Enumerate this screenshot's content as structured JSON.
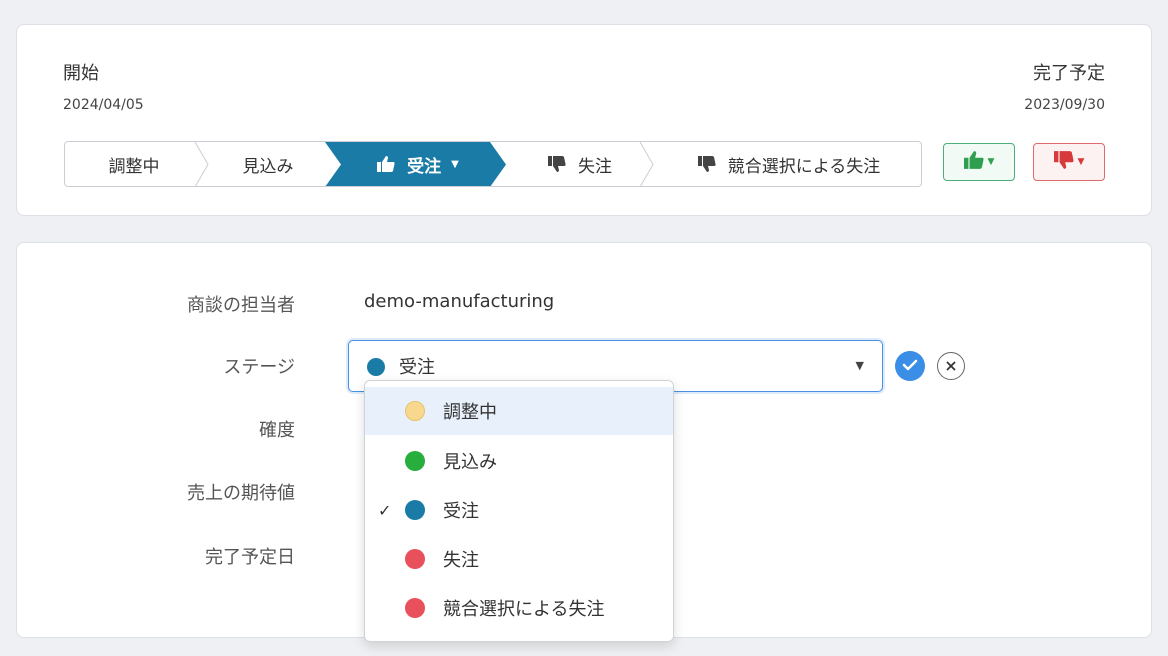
{
  "header": {
    "start_label": "開始",
    "start_date": "2024/04/05",
    "end_label": "完了予定",
    "end_date": "2023/09/30"
  },
  "stage_path": {
    "stages": [
      {
        "label": "調整中",
        "icon": null,
        "active": false
      },
      {
        "label": "見込み",
        "icon": null,
        "active": false
      },
      {
        "label": "受注",
        "icon": "thumbs-up-icon",
        "active": true
      },
      {
        "label": "失注",
        "icon": "thumbs-down-icon",
        "active": false
      },
      {
        "label": "競合選択による失注",
        "icon": "thumbs-down-icon",
        "active": false
      }
    ],
    "active_color": "#1a7ba6"
  },
  "vote_buttons": {
    "up_color": "#2e9e4f",
    "down_color": "#d63a3a"
  },
  "form": {
    "owner_label": "商談の担当者",
    "owner_value": "demo-manufacturing",
    "stage_label": "ステージ",
    "stage_value": "受注",
    "stage_color": "#1a7ba6",
    "probability_label": "確度",
    "expected_revenue_label": "売上の期待値",
    "close_date_label": "完了予定日"
  },
  "dropdown": {
    "options": [
      {
        "label": "調整中",
        "color": "#f7d88e",
        "selected": false
      },
      {
        "label": "見込み",
        "color": "#27ae3c",
        "selected": false
      },
      {
        "label": "受注",
        "color": "#1a7ba6",
        "selected": true
      },
      {
        "label": "失注",
        "color": "#e8505b",
        "selected": false
      },
      {
        "label": "競合選択による失注",
        "color": "#e8505b",
        "selected": false
      }
    ],
    "check_glyph": "✓"
  },
  "colors": {
    "confirm": "#3a8ee6"
  }
}
